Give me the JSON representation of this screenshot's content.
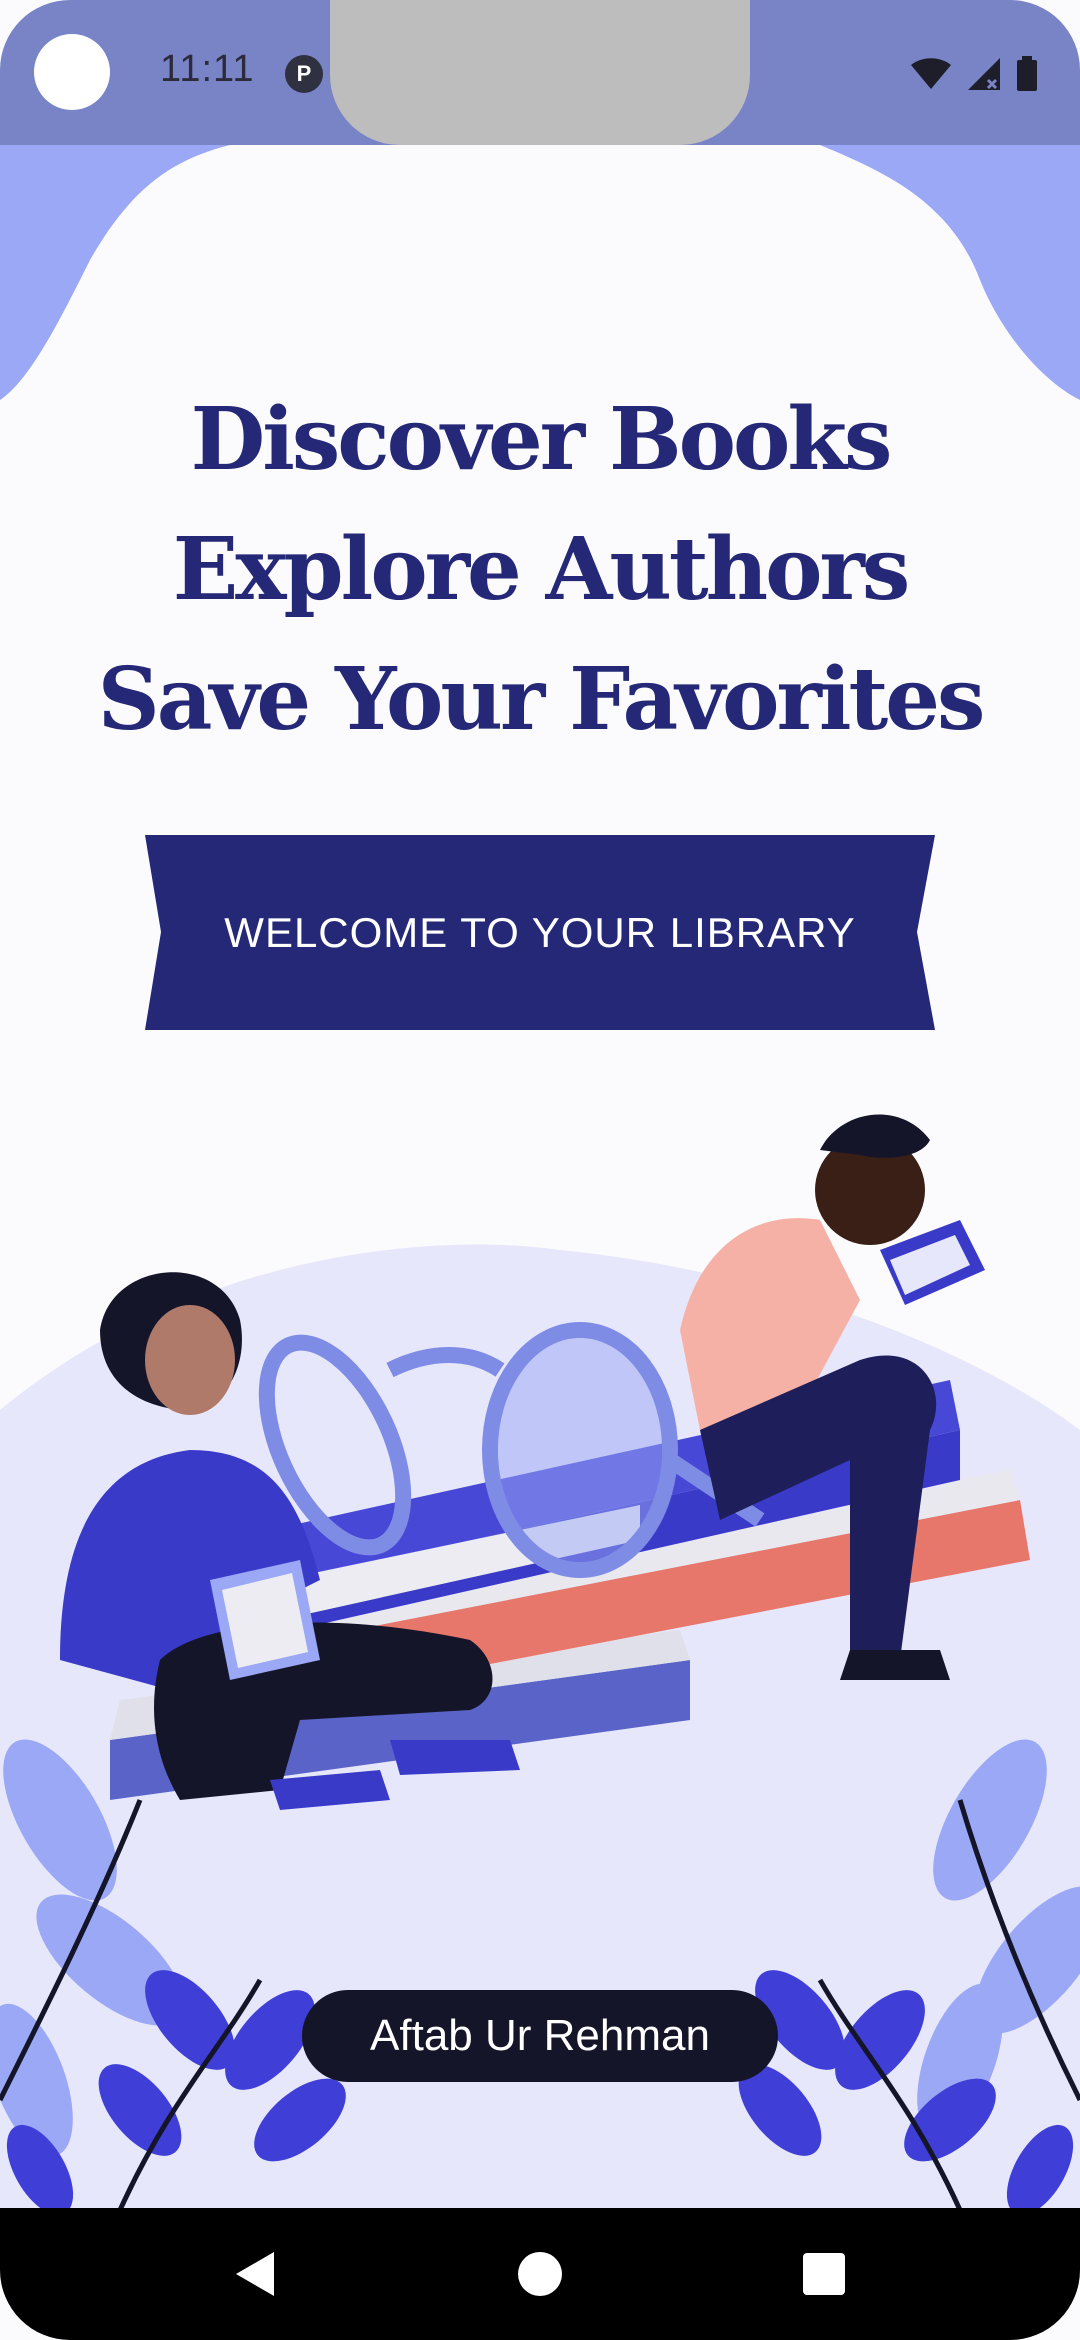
{
  "status_bar": {
    "time": "11:11",
    "app_icon_letter": "P",
    "icons": [
      "wifi-icon",
      "cellular-signal-icon",
      "battery-icon"
    ]
  },
  "headline": {
    "line1": "Discover Books",
    "line2": "Explore Authors",
    "line3": "Save Your Favorites"
  },
  "welcome_banner": {
    "label": "WELCOME TO YOUR LIBRARY"
  },
  "illustration": {
    "subject": "reading-people-books-glasses-illustration"
  },
  "author": {
    "name": "Aftab Ur Rehman"
  },
  "nav_bar": {
    "buttons": [
      "back-icon",
      "home-icon",
      "recents-icon"
    ]
  },
  "colors": {
    "status_bar": "#7884c6",
    "headline": "#242876",
    "banner": "#242876",
    "accent_light": "#9aa8f6",
    "background": "#fbfbfd",
    "author_pill": "#15152a"
  }
}
